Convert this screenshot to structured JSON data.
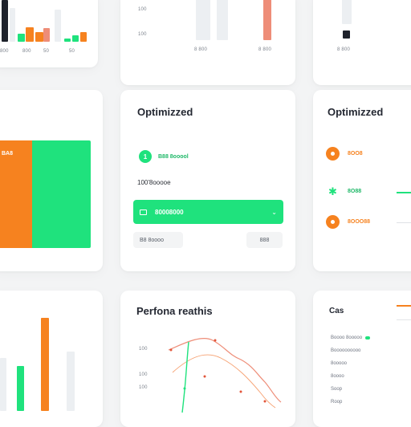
{
  "colors": {
    "green": "#1fe27d",
    "orange": "#f6821f",
    "salmon": "#ee8d78",
    "grey_bar": "#eceff2",
    "dark": "#1e222b"
  },
  "top_left_card": {
    "x_labels": [
      "800",
      "800",
      "50",
      "50"
    ]
  },
  "top_middle_card": {
    "y_labels": [
      "100",
      "100"
    ],
    "x_labels": [
      "8 800",
      "8 800"
    ]
  },
  "top_right_card": {
    "x_label": "8 800"
  },
  "middle_left_card": {
    "label": "BA8"
  },
  "middle_center_card": {
    "title": "Optimizzed",
    "step_number": "1",
    "step_label": "B88 8ooool",
    "section_label": "100'8ooooe",
    "primary_button_label": "80008000",
    "primary_button_icon": "chevron-down-icon",
    "secondary_left_label": "B8 8oooo",
    "secondary_right_label": "888"
  },
  "middle_right_card": {
    "title": "Optimizzed",
    "items": [
      {
        "label": "8OO8",
        "icon": "circle-icon",
        "color": "#f6821f"
      },
      {
        "label": "8O88",
        "icon": "star-icon",
        "color": "#1fe27d"
      },
      {
        "label": "8OOO88",
        "icon": "circle-icon",
        "color": "#f6821f"
      }
    ]
  },
  "bottom_center_card": {
    "title": "Perfona reathis",
    "y_labels": [
      "100",
      "100",
      "100"
    ]
  },
  "bottom_right_card": {
    "title": "Cas",
    "list": [
      "Boooo 8ooooo",
      "Boooooooooo",
      "8ooooo",
      "8oooo",
      "Soop",
      "Roop"
    ]
  }
}
